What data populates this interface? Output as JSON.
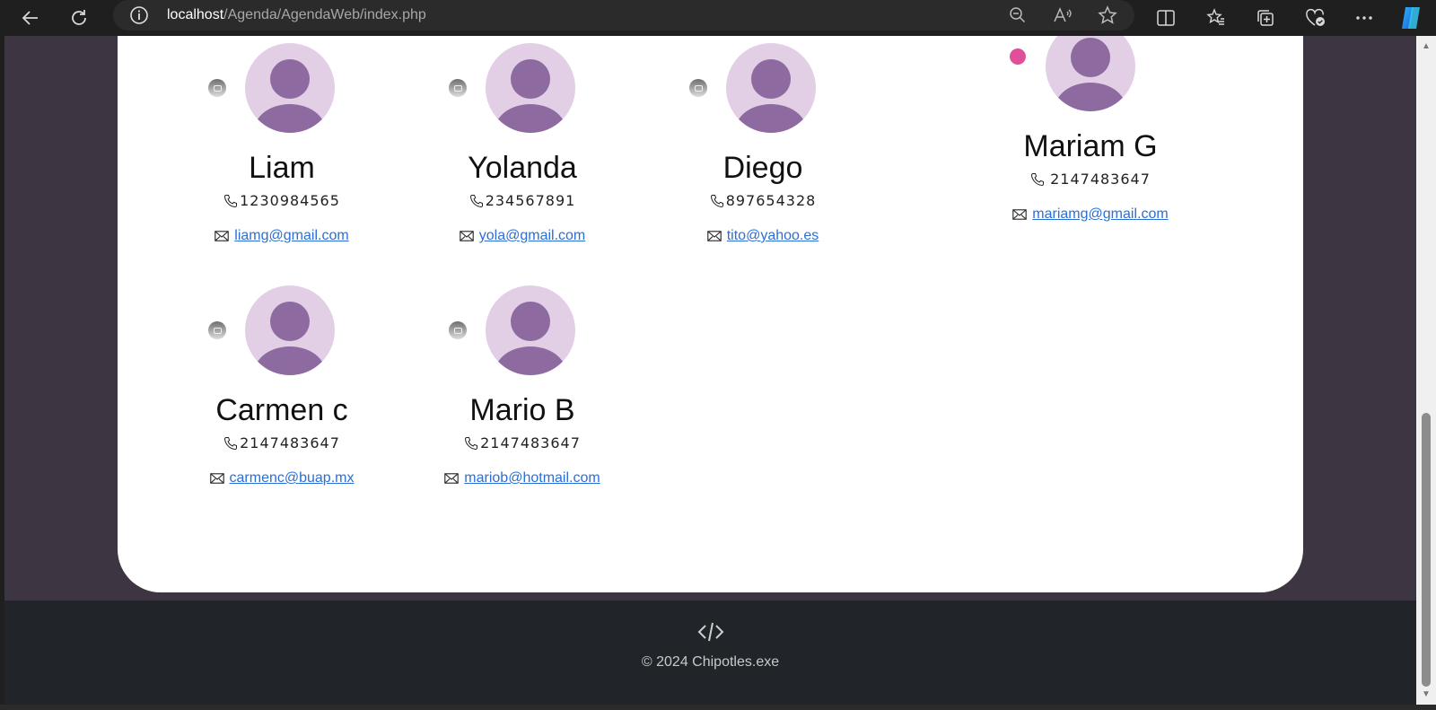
{
  "browser": {
    "url_host": "localhost",
    "url_path": "/Agenda/AgendaWeb/index.php"
  },
  "contacts": [
    {
      "name": "Liam",
      "phone": "1230984565",
      "email": "liamg@gmail.com"
    },
    {
      "name": "Yolanda",
      "phone": "234567891",
      "email": "yola@gmail.com"
    },
    {
      "name": "Diego",
      "phone": "897654328",
      "email": "tito@yahoo.es"
    },
    {
      "name": "Mariam G",
      "phone": "2147483647",
      "email": "mariamg@gmail.com"
    },
    {
      "name": "Carmen c",
      "phone": "2147483647",
      "email": "carmenc@buap.mx"
    },
    {
      "name": "Mario B",
      "phone": "2147483647",
      "email": "mariob@hotmail.com"
    }
  ],
  "footer": {
    "copyright": "© 2024 Chipotles.exe"
  }
}
